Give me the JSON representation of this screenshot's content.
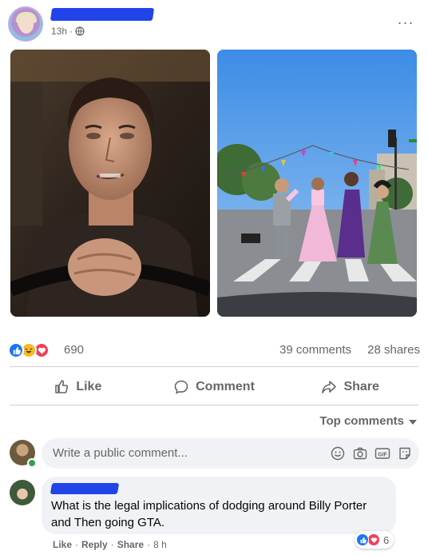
{
  "post": {
    "time": "13h",
    "visibility_icon": "globe-icon",
    "more_label": "···"
  },
  "stats": {
    "reaction_count": "690",
    "comments": "39 comments",
    "shares": "28 shares",
    "reactions": [
      "like",
      "haha",
      "love"
    ]
  },
  "actions": {
    "like": "Like",
    "comment": "Comment",
    "share": "Share"
  },
  "comments_section": {
    "sort_label": "Top comments",
    "composer_placeholder": "Write a public comment...",
    "composer_icons": [
      "emoji-icon",
      "camera-icon",
      "gif-icon",
      "sticker-icon"
    ]
  },
  "comment": {
    "text": "What is the legal implications of dodging around Billy Porter and Then going GTA.",
    "reaction_count": "6",
    "like_label": "Like",
    "reply_label": "Reply",
    "share_label": "Share",
    "time": "8 h",
    "separator": "·"
  },
  "colors": {
    "brand_blue": "#1877f2",
    "secondary_text": "#65676b",
    "bubble_bg": "#f0f2f5",
    "redaction": "#2044e8"
  }
}
